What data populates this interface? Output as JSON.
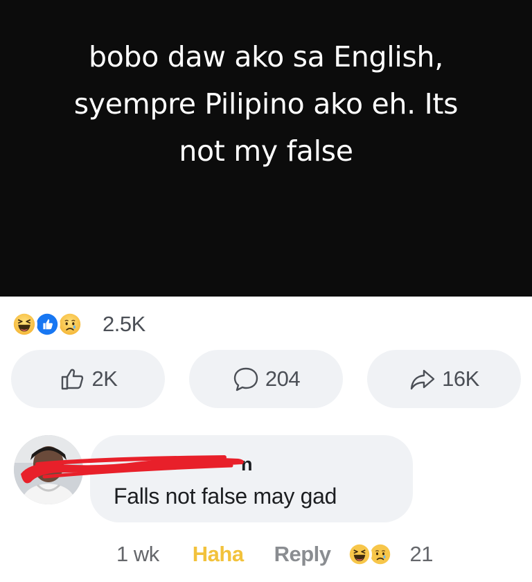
{
  "post": {
    "lines": [
      "bobo daw ako sa English,",
      "syempre Pilipino ako eh. Its",
      "not my false"
    ]
  },
  "reactions": {
    "icons": [
      "haha-icon",
      "like-icon",
      "sad-icon"
    ],
    "count": "2.5K"
  },
  "actions": {
    "like_count": "2K",
    "comment_count": "204",
    "share_count": "16K"
  },
  "comment": {
    "author_visible": "n",
    "text": "Falls not false may gad",
    "time": "1 wk",
    "reacted_label": "Haha",
    "reply_label": "Reply",
    "reaction_icons": [
      "haha-icon",
      "sad-icon"
    ],
    "reaction_count": "21"
  },
  "colors": {
    "banner_bg": "#0c0c0c",
    "bubble_bg": "#f0f2f5",
    "haha_yellow": "#f2c23c",
    "like_blue": "#1877f2",
    "redaction_red": "#e8202a"
  }
}
